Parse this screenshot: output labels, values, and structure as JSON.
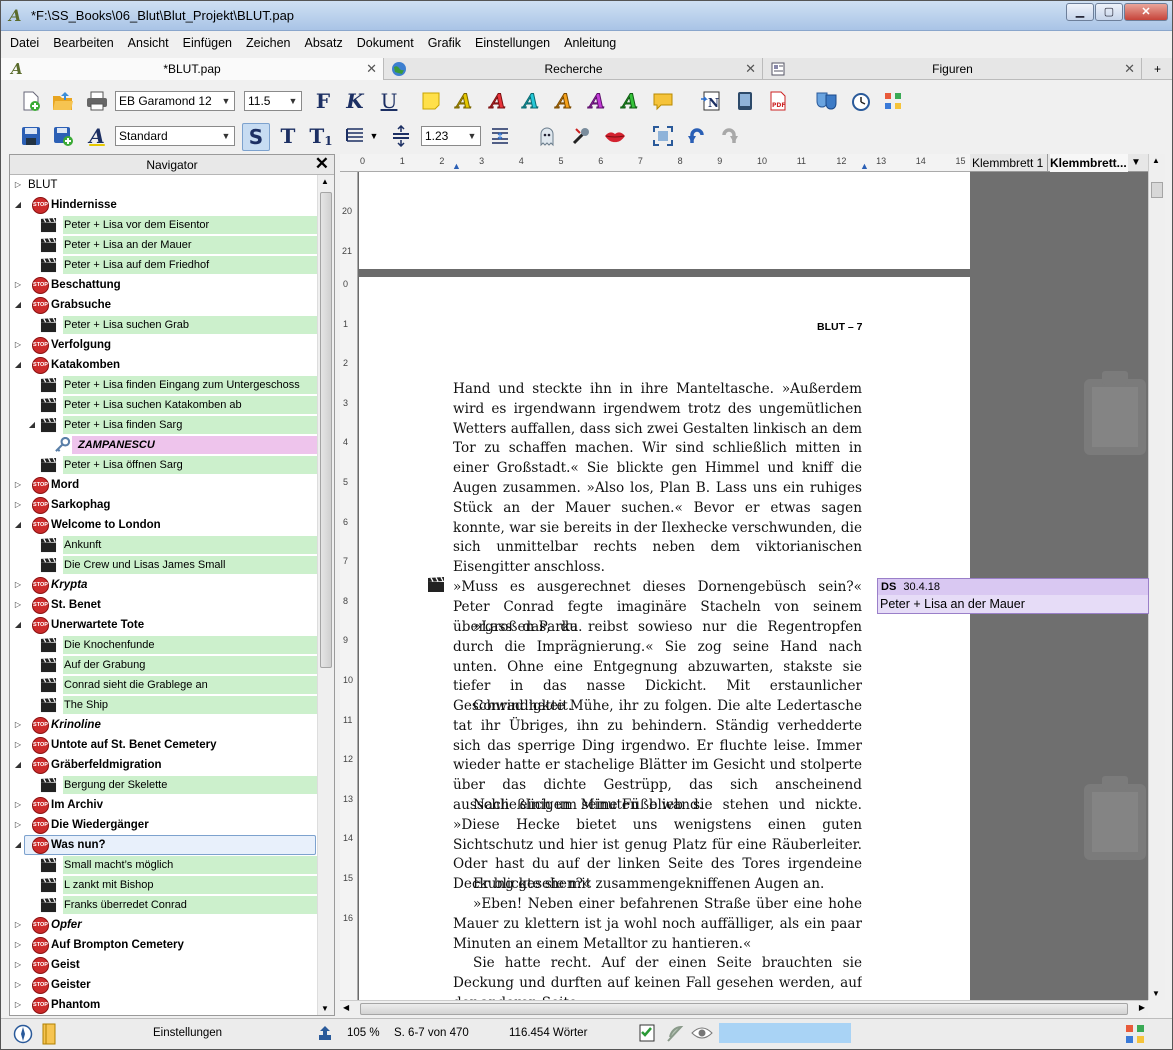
{
  "window": {
    "title": "*F:\\SS_Books\\06_Blut\\Blut_Projekt\\BLUT.pap"
  },
  "menu": [
    "Datei",
    "Bearbeiten",
    "Ansicht",
    "Einfügen",
    "Zeichen",
    "Absatz",
    "Dokument",
    "Grafik",
    "Einstellungen",
    "Anleitung"
  ],
  "tabs": [
    {
      "label": "*BLUT.pap"
    },
    {
      "label": "Recherche"
    },
    {
      "label": "Figuren"
    }
  ],
  "toolbar": {
    "font": "EB Garamond 12",
    "size": "11.5",
    "bold": "F",
    "italic": "K",
    "underline": "U",
    "style": "Standard",
    "btn_s": "S",
    "btn_t": "T",
    "btn_t1": "T",
    "btn_t1_sub": "1",
    "spacing": "1.23"
  },
  "navigator": {
    "title": "Navigator",
    "root": "BLUT",
    "rows": [
      {
        "kind": "chapter",
        "label": "Hindernisse",
        "italic": false
      },
      {
        "kind": "scene",
        "label": "Peter + Lisa vor dem Eisentor"
      },
      {
        "kind": "scene",
        "label": "Peter + Lisa an der Mauer"
      },
      {
        "kind": "scene",
        "label": "Peter + Lisa auf dem Friedhof"
      },
      {
        "kind": "chapter",
        "label": "Beschattung",
        "italic": false
      },
      {
        "kind": "chapter",
        "label": "Grabsuche",
        "italic": false
      },
      {
        "kind": "scene",
        "label": "Peter + Lisa suchen Grab"
      },
      {
        "kind": "chapter",
        "label": "Verfolgung",
        "italic": false
      },
      {
        "kind": "chapter",
        "label": "Katakomben",
        "italic": false
      },
      {
        "kind": "scene",
        "label": "Peter + Lisa finden Eingang zum Untergeschoss"
      },
      {
        "kind": "scene",
        "label": "Peter + Lisa suchen Katakomben ab"
      },
      {
        "kind": "scene",
        "label": "Peter + Lisa finden Sarg"
      },
      {
        "kind": "character",
        "label": "ZAMPANESCU"
      },
      {
        "kind": "scene",
        "label": "Peter + Lisa öffnen Sarg"
      },
      {
        "kind": "chapter",
        "label": "Mord",
        "italic": false
      },
      {
        "kind": "chapter",
        "label": "Sarkophag",
        "italic": false
      },
      {
        "kind": "chapter",
        "label": "Welcome to London",
        "italic": false
      },
      {
        "kind": "scene",
        "label": "Ankunft"
      },
      {
        "kind": "scene",
        "label": "Die Crew und Lisas James Small"
      },
      {
        "kind": "chapter",
        "label": "Krypta",
        "italic": true
      },
      {
        "kind": "chapter",
        "label": "St. Benet",
        "italic": false
      },
      {
        "kind": "chapter",
        "label": "Unerwartete Tote",
        "italic": false
      },
      {
        "kind": "scene",
        "label": "Die Knochenfunde"
      },
      {
        "kind": "scene",
        "label": "Auf der Grabung"
      },
      {
        "kind": "scene",
        "label": "Conrad sieht die Grablege an"
      },
      {
        "kind": "scene",
        "label": "The Ship"
      },
      {
        "kind": "chapter",
        "label": "Krinoline",
        "italic": true
      },
      {
        "kind": "chapter",
        "label": "Untote auf St. Benet Cemetery",
        "italic": false
      },
      {
        "kind": "chapter",
        "label": "Gräberfeldmigration",
        "italic": false
      },
      {
        "kind": "scene",
        "label": "Bergung der Skelette"
      },
      {
        "kind": "chapter",
        "label": "Im Archiv",
        "italic": false
      },
      {
        "kind": "chapter",
        "label": "Die Wiedergänger",
        "italic": false
      },
      {
        "kind": "chapter",
        "label": "Was nun?",
        "italic": false,
        "selected": true
      },
      {
        "kind": "scene",
        "label": "Small macht’s möglich"
      },
      {
        "kind": "scene",
        "label": "L zankt mit Bishop"
      },
      {
        "kind": "scene",
        "label": "Franks überredet Conrad"
      },
      {
        "kind": "chapter",
        "label": "Opfer",
        "italic": true
      },
      {
        "kind": "chapter",
        "label": "Auf Brompton Cemetery",
        "italic": false
      },
      {
        "kind": "chapter",
        "label": "Geist",
        "italic": false
      },
      {
        "kind": "chapter",
        "label": "Geister",
        "italic": false
      },
      {
        "kind": "chapter",
        "label": "Phantom",
        "italic": false
      }
    ]
  },
  "ruler": {
    "h": [
      "0",
      "1",
      "2",
      "3",
      "4",
      "5",
      "6",
      "7",
      "8",
      "9",
      "10",
      "11",
      "12",
      "13",
      "14",
      "15"
    ],
    "v_top": [
      "20",
      "21"
    ],
    "v_main": [
      "0",
      "1",
      "2",
      "3",
      "4",
      "5",
      "6",
      "7",
      "8",
      "9",
      "10",
      "11",
      "12",
      "13",
      "14",
      "15",
      "16"
    ]
  },
  "document": {
    "running_head": "BLUT – 7",
    "paragraphs": [
      {
        "text": "Hand und steckte ihn in ihre Manteltasche. »Außerdem wird es irgendwann irgendwem trotz des ungemütlichen Wetters auffallen, dass sich zwei Gestalten linkisch an dem Tor zu schaffen machen. Wir sind schließlich mitten in einer Großstadt.« Sie blickte gen Himmel und kniff die Augen zusammen. »Also los, Plan B. Lass uns ein ruhiges Stück an der Mauer suchen.« Bevor er etwas sagen konnte, war sie bereits in der Ilexhecke verschwunden, die sich unmittelbar rechts neben dem viktorianischen Eisengitter anschloss.",
        "indent": false
      },
      {
        "text": "»Muss es ausgerechnet dieses Dornengebüsch sein?« Peter Conrad fegte imaginäre Stacheln von seinem übergroßen Parka.",
        "indent": false
      },
      {
        "text": "»Lass das, du reibst sowieso nur die Regentropfen durch die Imprägnierung.« Sie zog seine Hand nach unten. Ohne eine Entgegnung abzuwarten, stakste sie tiefer in das nasse Dickicht. Mit erstaunlicher Geschwindigkeit.",
        "indent": true
      },
      {
        "text": "Conrad hatte Mühe, ihr zu folgen. Die alte Ledertasche tat ihr Übriges, ihn zu behindern. Ständig verhedderte sich das sperrige Ding irgendwo. Er fluchte leise. Immer wieder hatte er stachelige Blätter im Gesicht und stolperte über das dichte Gestrüpp, das sich anscheinend ausschließlich um seine Füße wand.",
        "indent": true
      },
      {
        "text": "Nach einigen Minuten blieb sie stehen und nickte. »Diese Hecke bietet uns wenigstens einen guten Sichtschutz und hier ist genug Platz für eine Räuberleiter. Oder hast du auf der linken Seite des Tores irgendeine Deckung gesehen?«",
        "indent": true
      },
      {
        "text": "Er blickte sie mit zusammengekniffenen Augen an.",
        "indent": true
      },
      {
        "text": "»Eben! Neben einer befahrenen Straße über eine hohe Mauer zu klettern ist ja wohl noch auffälliger, als ein paar Minuten an einem Metalltor zu hantieren.«",
        "indent": true
      },
      {
        "text": "Sie hatte recht. Auf der einen Seite brauchten sie Deckung und durften auf keinen Fall gesehen werden, auf der anderen Seite",
        "indent": true
      }
    ]
  },
  "note": {
    "initials": "DS",
    "date": "30.4.18",
    "text": "Peter + Lisa an der Mauer"
  },
  "clipboard": {
    "tab1": "Klemmbrett 1",
    "tab2": "Klemmbrett..."
  },
  "status": {
    "settings": "Einstellungen",
    "zoom": "105 %",
    "pages": "S. 6-7 von 470",
    "words": "116.454 Wörter"
  }
}
